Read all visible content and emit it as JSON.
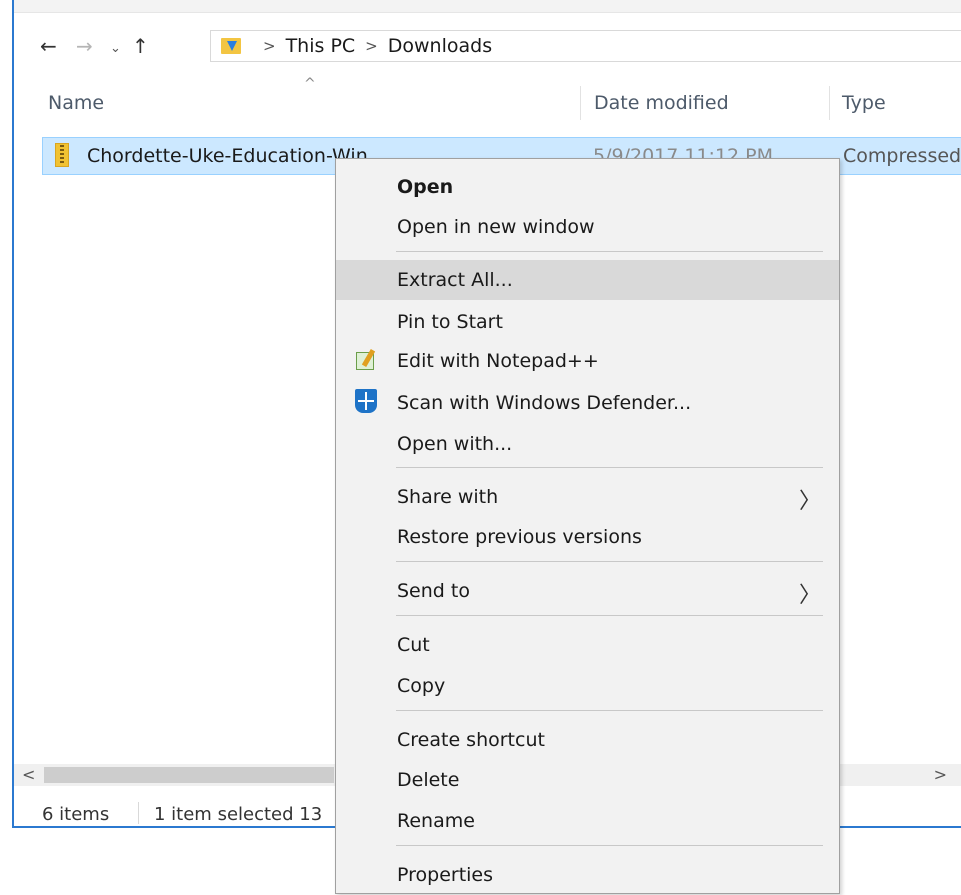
{
  "explorer": {
    "nav": {
      "back": "←",
      "forward": "→",
      "recent": "⌄",
      "up": "↑"
    },
    "breadcrumb": [
      "This PC",
      "Downloads"
    ],
    "crumb_separator": ">",
    "columns": {
      "name": "Name",
      "date": "Date modified",
      "type": "Type"
    },
    "sort_indicator": "^",
    "file": {
      "name": "Chordette-Uke-Education-Win",
      "date": "5/9/2017 11:12 PM",
      "type": "Compressed"
    },
    "status": {
      "items": "6 items",
      "selected": "1 item selected  13"
    },
    "scroll_left": "<",
    "scroll_right": ">"
  },
  "context_menu": {
    "open": "Open",
    "open_new_window": "Open in new window",
    "extract_all": "Extract All...",
    "pin_to_start": "Pin to Start",
    "edit_notepad": "Edit with Notepad++",
    "scan_defender": "Scan with Windows Defender...",
    "open_with": "Open with...",
    "share_with": "Share with",
    "restore_previous": "Restore previous versions",
    "send_to": "Send to",
    "cut": "Cut",
    "copy": "Copy",
    "create_shortcut": "Create shortcut",
    "delete": "Delete",
    "rename": "Rename",
    "properties": "Properties",
    "submenu_chevron": "〉"
  },
  "colors": {
    "selection": "#cce8ff",
    "window_border": "#2b79d0",
    "menu_bg": "#f2f2f2",
    "menu_hover": "#d9d9d9"
  }
}
